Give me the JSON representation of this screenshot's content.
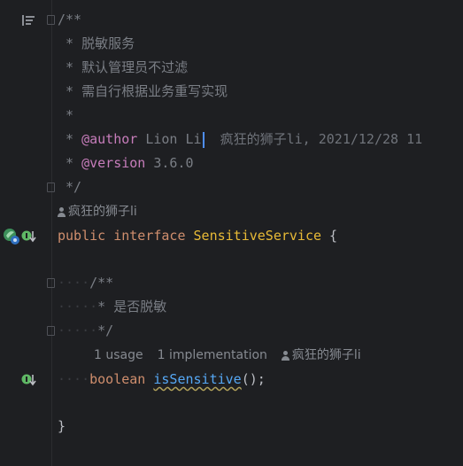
{
  "editor": {
    "lines": {
      "doc_open": "/**",
      "doc_desc1": " * 脱敏服务",
      "doc_desc2": " * 默认管理员不过滤",
      "doc_desc3": " * 需自行根据业务重写实现",
      "doc_blank": " *",
      "doc_author_prefix": " * ",
      "doc_author_tag": "@author",
      "doc_author_value": " Lion Li",
      "doc_author_blame": "  疯狂的狮子li, 2021/12/28 11",
      "doc_version_prefix": " * ",
      "doc_version_tag": "@version",
      "doc_version_value": " 3.6.0",
      "doc_close": " */",
      "decl_public": "public",
      "decl_interface": " interface ",
      "decl_name": "SensitiveService",
      "decl_brace": " {",
      "m_indent1": "····",
      "m_doc_open": "/**",
      "m_indent2": "·····",
      "m_doc_desc": "* 是否脱敏",
      "m_indent3": "·····",
      "m_doc_close": "*/",
      "m_indent4": "····",
      "m_type": "boolean",
      "m_space": " ",
      "m_name": "isSensitive",
      "m_tail": "();",
      "close_brace": "}"
    },
    "inlays": {
      "class_author": "疯狂的狮子li",
      "method_usages": "1 usage",
      "method_impls": "1 implementation",
      "method_author": "疯狂的狮子li"
    },
    "gutter": {
      "structure_icon": "structure-icon",
      "fold_icon": "fold-icon",
      "implemented_icon": "implemented-icon",
      "spring_icon": "spring-bean-icon"
    },
    "colors": {
      "background": "#1e1f22",
      "comment": "#7a7e85",
      "doc_tag": "#c77dbb",
      "keyword": "#cf8e6d",
      "class_name": "#e8ba36",
      "method_name": "#56a8f5",
      "caret": "#4e8ef7"
    }
  }
}
